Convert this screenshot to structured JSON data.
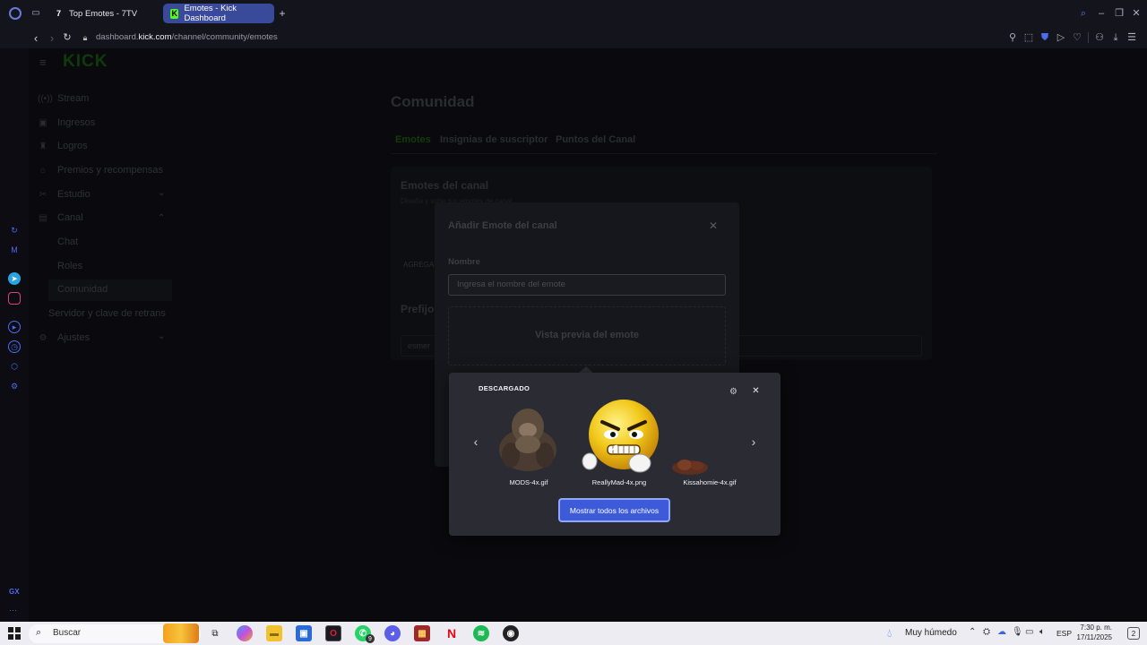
{
  "browser": {
    "tabs": [
      {
        "title": "Top Emotes - 7TV",
        "favicon": "7tv-icon"
      },
      {
        "title": "Emotes - Kick Dashboard",
        "favicon": "kick-icon"
      }
    ],
    "new_tab_label": "+",
    "url_prefix": "dashboard.",
    "url_domain": "kick.com",
    "url_path": "/channel/community/emotes"
  },
  "sidebar": {
    "logo": "KICK",
    "items": [
      {
        "label": "Stream",
        "icon": "stream-icon"
      },
      {
        "label": "Ingresos",
        "icon": "money-icon"
      },
      {
        "label": "Logros",
        "icon": "trophy-icon"
      },
      {
        "label": "Premios y recompensas",
        "icon": "gift-icon"
      },
      {
        "label": "Estudio",
        "icon": "studio-icon"
      },
      {
        "label": "Canal",
        "icon": "channel-icon"
      },
      {
        "label": "Chat"
      },
      {
        "label": "Roles"
      },
      {
        "label": "Comunidad"
      },
      {
        "label": "Servidor y clave de retrans"
      },
      {
        "label": "Ajustes",
        "icon": "settings-icon"
      }
    ],
    "opera_bottom": "GX",
    "opera_more": "···"
  },
  "main": {
    "title": "Comunidad",
    "tabs": [
      "Emotes",
      "Insignias de suscriptor",
      "Puntos del Canal"
    ],
    "section_title": "Emotes del canal",
    "section_sub": "Diseña y sube tus emotes de canal",
    "add_label": "AGREGAR",
    "prefix_title": "Prefijo",
    "prefix_value": "esmer"
  },
  "modal": {
    "title": "Añadir Emote del canal",
    "name_label": "Nombre",
    "name_placeholder": "Ingresa el nombre del emote",
    "preview_label": "Vista previa del emote"
  },
  "downloads": {
    "header": "DESCARGADO",
    "files": [
      {
        "name": "MODS-4x.gif"
      },
      {
        "name": "ReallyMad-4x.png"
      },
      {
        "name": "Kissahomie-4x.gif"
      }
    ],
    "show_all": "Mostrar todos los archivos"
  },
  "taskbar": {
    "search_label": "Buscar",
    "weather": "Muy húmedo",
    "lang": "ESP",
    "time": "7:30 p. m.",
    "date": "17/11/2025",
    "notif_count": "2",
    "whatsapp_badge": "9"
  }
}
